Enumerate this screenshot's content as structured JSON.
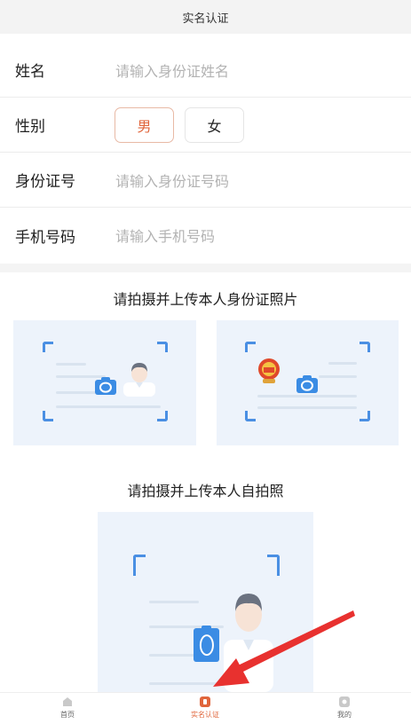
{
  "header": {
    "title": "实名认证"
  },
  "form": {
    "name": {
      "label": "姓名",
      "placeholder": "请输入身份证姓名"
    },
    "gender": {
      "label": "性别",
      "options": [
        "男",
        "女"
      ],
      "selected": "男"
    },
    "id_number": {
      "label": "身份证号",
      "placeholder": "请输入身份证号码"
    },
    "phone": {
      "label": "手机号码",
      "placeholder": "请输入手机号码"
    }
  },
  "id_section": {
    "title": "请拍摄并上传本人身份证照片",
    "front_card": {
      "icon": "camera-icon"
    },
    "back_card": {
      "icon": "camera-icon"
    }
  },
  "selfie_section": {
    "title": "请拍摄并上传本人自拍照",
    "icon": "camera-icon"
  },
  "tabbar": {
    "items": [
      {
        "label": "首页",
        "icon": "home-icon"
      },
      {
        "label": "实名认证",
        "icon": "verify-icon",
        "active": true
      },
      {
        "label": "我的",
        "icon": "profile-icon"
      }
    ]
  },
  "colors": {
    "accent": "#e0653b",
    "camera_blue": "#3b8ce4",
    "card_bg": "#edf3fb",
    "annotation_arrow": "#e8312f"
  }
}
